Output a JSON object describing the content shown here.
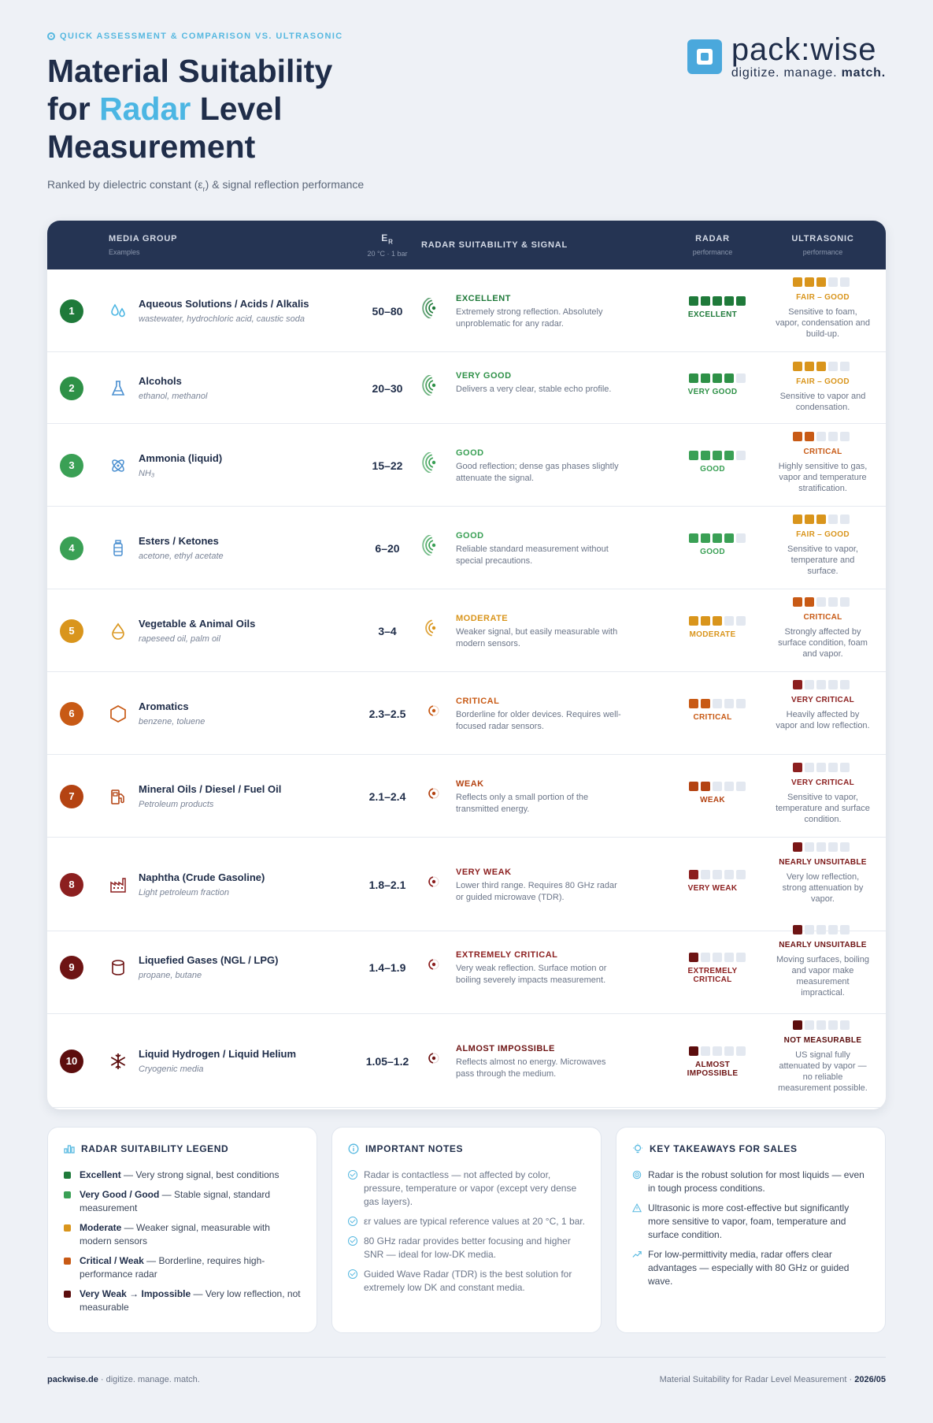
{
  "header": {
    "kicker": "QUICK ASSESSMENT & COMPARISON VS. ULTRASONIC",
    "title_line1": "Material Suitability",
    "title_for": "for",
    "title_accent": "Radar",
    "title_level": "Level",
    "title_line3": "Measurement",
    "subtitle_pre": "Ranked by dielectric constant (ε",
    "subtitle_sub": "r",
    "subtitle_post": ") & signal reflection performance"
  },
  "logo": {
    "brand": "pack:wise",
    "tag_pre": "digitize. manage.",
    "tag_bold": "match."
  },
  "table": {
    "col_media": "MEDIA GROUP",
    "col_media_sub": "Examples",
    "col_er": "ER",
    "col_er_sub": "20 °C · 1 bar",
    "col_suit": "RADAR SUITABILITY & SIGNAL",
    "col_radar": "RADAR",
    "col_radar_sub": "performance",
    "col_us": "ULTRASONIC",
    "col_us_sub": "performance",
    "rows": [
      {
        "num": "1",
        "name": "Aqueous Solutions / Acids / Alkalis",
        "examples": "wastewater, hydrochloric acid, caustic soda",
        "er": "50–80",
        "rating": "EXCELLENT",
        "desc": "Extremely strong reflection. Absolutely unproblematic for any radar.",
        "radar_score": 5,
        "radar_label": "EXCELLENT",
        "us_score": 3,
        "us_label": "FAIR – GOOD",
        "us_desc": "Sensitive to foam, vapor, condensation and build-up.",
        "icon": "drops-icon"
      },
      {
        "num": "2",
        "name": "Alcohols",
        "examples": "ethanol, methanol",
        "er": "20–30",
        "rating": "VERY GOOD",
        "desc": "Delivers a very clear, stable echo profile.",
        "radar_score": 4,
        "radar_label": "VERY GOOD",
        "us_score": 3,
        "us_label": "FAIR – GOOD",
        "us_desc": "Sensitive to vapor and condensation.",
        "icon": "flask-icon"
      },
      {
        "num": "3",
        "name": "Ammonia (liquid)",
        "examples": "NH₃",
        "er": "15–22",
        "rating": "GOOD",
        "desc": "Good reflection; dense gas phases slightly attenuate the signal.",
        "radar_score": 4,
        "radar_label": "GOOD",
        "us_score": 2,
        "us_label": "CRITICAL",
        "us_desc": "Highly sensitive to gas, vapor and temperature stratification.",
        "icon": "atom-icon"
      },
      {
        "num": "4",
        "name": "Esters / Ketones",
        "examples": "acetone, ethyl acetate",
        "er": "6–20",
        "rating": "GOOD",
        "desc": "Reliable standard measurement without special precautions.",
        "radar_score": 4,
        "radar_label": "GOOD",
        "us_score": 3,
        "us_label": "FAIR – GOOD",
        "us_desc": "Sensitive to vapor, temperature and surface.",
        "icon": "bottle-icon"
      },
      {
        "num": "5",
        "name": "Vegetable & Animal Oils",
        "examples": "rapeseed oil, palm oil",
        "er": "3–4",
        "rating": "MODERATE",
        "desc": "Weaker signal, but easily measurable with modern sensors.",
        "radar_score": 3,
        "radar_label": "MODERATE",
        "us_score": 2,
        "us_label": "CRITICAL",
        "us_desc": "Strongly affected by surface condition, foam and vapor.",
        "icon": "oil-drop-icon"
      },
      {
        "num": "6",
        "name": "Aromatics",
        "examples": "benzene, toluene",
        "er": "2.3–2.5",
        "rating": "CRITICAL",
        "desc": "Borderline for older devices. Requires well-focused radar sensors.",
        "radar_score": 2,
        "radar_label": "CRITICAL",
        "us_score": 1,
        "us_label": "VERY CRITICAL",
        "us_desc": "Heavily affected by vapor and low reflection.",
        "icon": "hexagon-icon"
      },
      {
        "num": "7",
        "name": "Mineral Oils / Diesel / Fuel Oil",
        "examples": "Petroleum products",
        "er": "2.1–2.4",
        "rating": "WEAK",
        "desc": "Reflects only a small portion of the transmitted energy.",
        "radar_score": 2,
        "radar_label": "WEAK",
        "us_score": 1,
        "us_label": "VERY CRITICAL",
        "us_desc": "Sensitive to vapor, temperature and surface condition.",
        "icon": "fuel-pump-icon"
      },
      {
        "num": "8",
        "name": "Naphtha (Crude Gasoline)",
        "examples": "Light petroleum fraction",
        "er": "1.8–2.1",
        "rating": "VERY WEAK",
        "desc": "Lower third range. Requires 80 GHz radar or guided microwave (TDR).",
        "radar_score": 1,
        "radar_label": "VERY WEAK",
        "us_score": 1,
        "us_label": "NEARLY UNSUITABLE",
        "us_desc": "Very low reflection, strong attenuation by vapor.",
        "icon": "factory-icon"
      },
      {
        "num": "9",
        "name": "Liquefied Gases (NGL / LPG)",
        "examples": "propane, butane",
        "er": "1.4–1.9",
        "rating": "EXTREMELY CRITICAL",
        "desc": "Very weak reflection. Surface motion or boiling severely impacts measurement.",
        "radar_score": 1,
        "radar_label": "EXTREMELY CRITICAL",
        "us_score": 1,
        "us_label": "NEARLY UNSUITABLE",
        "us_desc": "Moving surfaces, boiling and vapor make measurement impractical.",
        "icon": "cylinder-icon"
      },
      {
        "num": "10",
        "name": "Liquid Hydrogen / Liquid Helium",
        "examples": "Cryogenic media",
        "er": "1.05–1.2",
        "rating": "ALMOST IMPOSSIBLE",
        "desc": "Reflects almost no energy. Microwaves pass through the medium.",
        "radar_score": 1,
        "radar_label": "ALMOST IMPOSSIBLE",
        "us_score": 1,
        "us_label": "NOT MEASURABLE",
        "us_desc": "US signal fully attenuated by vapor — no reliable measurement possible.",
        "icon": "snowflake-icon"
      }
    ]
  },
  "colors": {
    "row": [
      "#1f7a3a",
      "#2e9147",
      "#3aa055",
      "#3aa055",
      "#d9951c",
      "#c85a15",
      "#b44312",
      "#8c1f1f",
      "#6e1414",
      "#5c0d0d"
    ],
    "us": [
      "#d9951c",
      "#d9951c",
      "#c85a15",
      "#d9951c",
      "#c85a15",
      "#8c1f1f",
      "#8c1f1f",
      "#7a1616",
      "#6e1414",
      "#5c0d0d"
    ],
    "empty": "#e3e8f0"
  },
  "legend": {
    "title": "RADAR SUITABILITY LEGEND",
    "items": [
      {
        "bold": "Excellent",
        "text": " — Very strong signal, best conditions",
        "color": "#1f7a3a"
      },
      {
        "bold": "Very Good / Good",
        "text": " — Stable signal, standard measurement",
        "color": "#3aa055"
      },
      {
        "bold": "Moderate",
        "text": " — Weaker signal, measurable with modern sensors",
        "color": "#d9951c"
      },
      {
        "bold": "Critical / Weak",
        "text": " — Borderline, requires high-performance radar",
        "color": "#c85a15"
      },
      {
        "bold": "Very Weak → Impossible",
        "text": " — Very low reflection, not measurable",
        "color": "#5c0d0d"
      }
    ]
  },
  "notes": {
    "title": "IMPORTANT NOTES",
    "items": [
      "Radar is contactless — not affected by color, pressure, temperature or vapor (except very dense gas layers).",
      "εr values are typical reference values at 20 °C, 1 bar.",
      "80 GHz radar provides better focusing and higher SNR — ideal for low-DK media.",
      "Guided Wave Radar (TDR) is the best solution for extremely low DK and constant media."
    ]
  },
  "takeaways": {
    "title": "KEY TAKEAWAYS FOR SALES",
    "items": [
      "Radar is the robust solution for most liquids — even in tough process conditions.",
      "Ultrasonic is more cost-effective but significantly more sensitive to vapor, foam, temperature and surface condition.",
      "For low-permittivity media, radar offers clear advantages — especially with 80 GHz or guided wave."
    ]
  },
  "footer": {
    "site": "packwise.de",
    "sep": "·",
    "slogan": "digitize. manage. match.",
    "doc": "Material Suitability for Radar Level Measurement",
    "date": "2026/05"
  }
}
